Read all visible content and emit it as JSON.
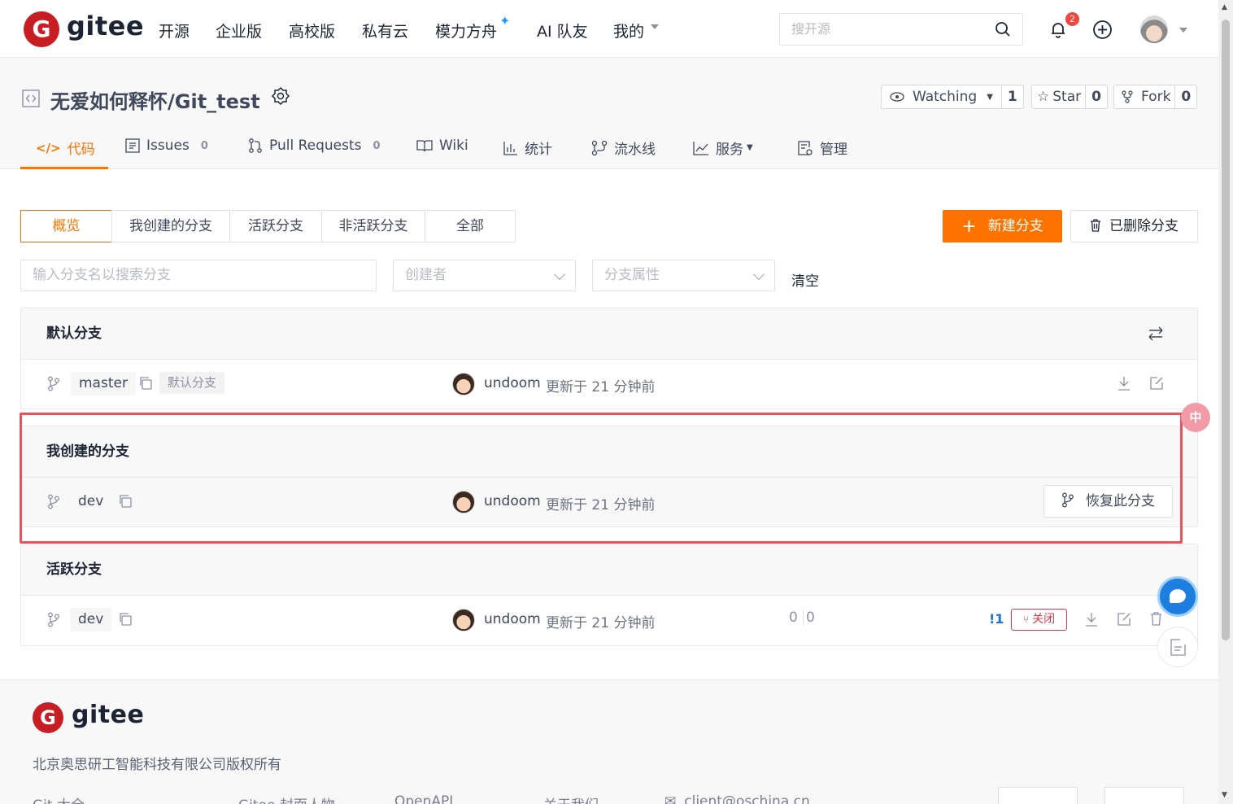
{
  "brand": {
    "logo_letter": "G",
    "name": "gitee"
  },
  "nav": {
    "items": [
      "开源",
      "企业版",
      "高校版",
      "私有云",
      "模力方舟",
      "AI 队友",
      "我的"
    ],
    "search_placeholder": "搜开源",
    "notification_count": "2"
  },
  "repo": {
    "title": "无爱如何释怀/Git_test",
    "watch": {
      "label": "Watching",
      "count": "1"
    },
    "star": {
      "label": "Star",
      "count": "0"
    },
    "fork": {
      "label": "Fork",
      "count": "0"
    }
  },
  "tabs": [
    {
      "label": "代码"
    },
    {
      "label": "Issues",
      "count": "0"
    },
    {
      "label": "Pull Requests",
      "count": "0"
    },
    {
      "label": "Wiki"
    },
    {
      "label": "统计"
    },
    {
      "label": "流水线"
    },
    {
      "label": "服务"
    },
    {
      "label": "管理"
    }
  ],
  "filters": {
    "segments": [
      "概览",
      "我创建的分支",
      "活跃分支",
      "非活跃分支",
      "全部"
    ],
    "new_branch": "新建分支",
    "deleted_branches": "已删除分支",
    "search_placeholder": "输入分支名以搜索分支",
    "creator_placeholder": "创建者",
    "attribute_placeholder": "分支属性",
    "clear": "清空"
  },
  "sections": {
    "default": {
      "title": "默认分支",
      "branch": "master",
      "tag": "默认分支",
      "author": "undoom",
      "updated": "更新于 21 分钟前"
    },
    "mine": {
      "title": "我创建的分支",
      "branch": "dev",
      "author": "undoom",
      "updated": "更新于 21 分钟前",
      "restore": "恢复此分支"
    },
    "active": {
      "title": "活跃分支",
      "branch": "dev",
      "author": "undoom",
      "updated": "更新于 21 分钟前",
      "behind": "0",
      "ahead": "0",
      "pr_count": "!1",
      "close_label": "关闭"
    }
  },
  "footer": {
    "company": "北京奥思研工智能科技有限公司版权所有",
    "links": [
      "Git 大全",
      "Gitee 封面人物",
      "OpenAPI",
      "关于我们",
      "client@oschina.cn"
    ]
  },
  "colors": {
    "accent": "#fe7300",
    "brand": "#c71d23",
    "frame": "#e8545c"
  }
}
